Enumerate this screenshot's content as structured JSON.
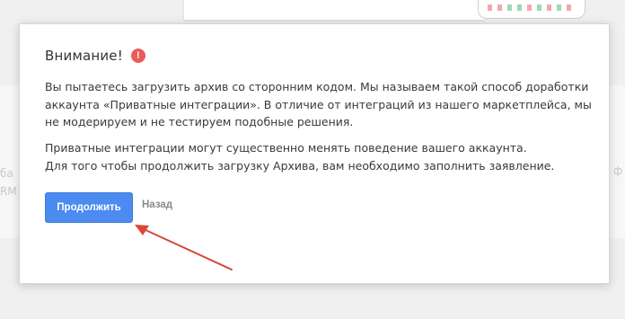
{
  "background": {
    "left_text_lines": [
      "ба",
      "RM"
    ],
    "right_text": "ф"
  },
  "modal": {
    "title": "Внимание!",
    "warning_icon": "exclamation-circle-icon",
    "paragraph1_lines": [
      "Вы пытаетесь загрузить архив со сторонним кодом. Мы называем такой способ доработки",
      "аккаунта «Приватные интеграции». В отличие от интеграций из нашего маркетплейса, мы",
      "не модерируем и не тестируем подобные решения."
    ],
    "paragraph2_lines": [
      "Приватные интеграции могут существенно менять поведение вашего аккаунта.",
      "Для того чтобы продолжить загрузку Архива, вам необходимо заполнить заявление."
    ],
    "continue_label": "Продолжить",
    "back_label": "Назад"
  },
  "colors": {
    "primary": "#4c8bf0",
    "warning": "#e85c5c",
    "annotation": "#d9473b"
  }
}
